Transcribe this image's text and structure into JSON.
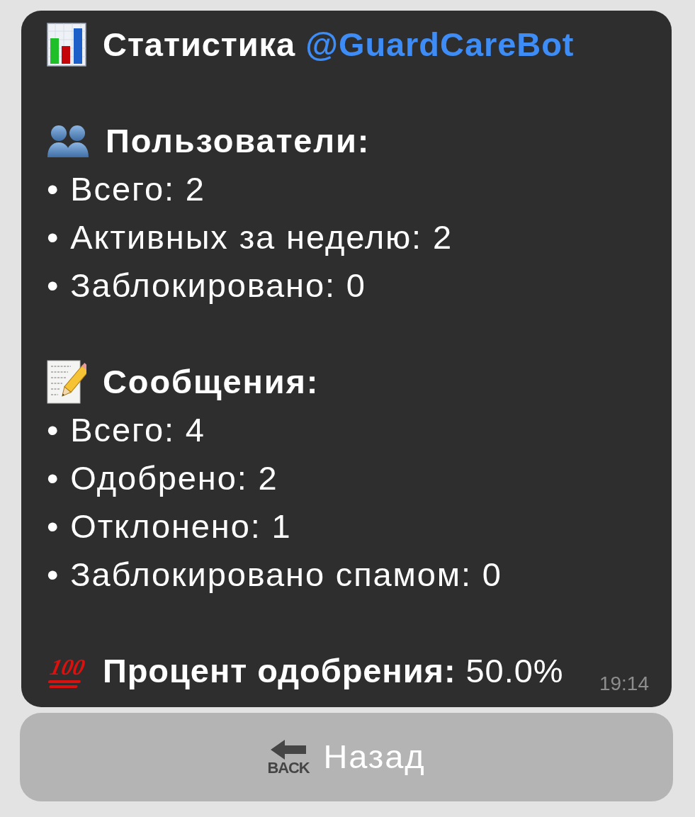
{
  "message": {
    "title": {
      "text": "Статистика",
      "mention": "@GuardCareBot"
    },
    "users": {
      "heading": "Пользователи:",
      "items": [
        "• Всего: 2",
        "• Активных за неделю: 2",
        "• Заблокировано: 0"
      ]
    },
    "messages": {
      "heading": "Сообщения:",
      "items": [
        "• Всего: 4",
        "• Одобрено: 2",
        "• Отклонено: 1",
        "• Заблокировано спамом: 0"
      ]
    },
    "summary": {
      "icon_text": "100",
      "text": "**Процент одобрения:** 50.0%"
    },
    "time": "19:14"
  },
  "buttons": [
    {
      "label": "Назад",
      "icon_text": "BACK"
    }
  ]
}
